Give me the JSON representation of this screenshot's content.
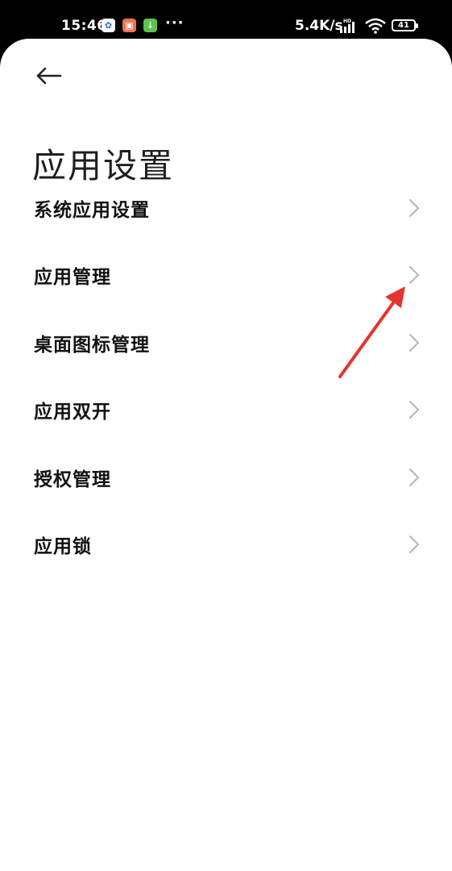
{
  "status_bar": {
    "time": "15:46",
    "app_icons": [
      {
        "name": "baidu-icon",
        "glyph": "✿"
      },
      {
        "name": "shopping-icon",
        "glyph": "▣"
      },
      {
        "name": "download-icon",
        "glyph": "↓"
      }
    ],
    "more": "···",
    "network_speed": "5.4K/s",
    "signal_label": "HD",
    "battery": "41"
  },
  "header": {
    "back_icon": "back-arrow-icon",
    "title": "应用设置"
  },
  "settings": {
    "items": [
      {
        "label": "系统应用设置"
      },
      {
        "label": "应用管理"
      },
      {
        "label": "桌面图标管理"
      },
      {
        "label": "应用双开"
      },
      {
        "label": "授权管理"
      },
      {
        "label": "应用锁"
      }
    ]
  },
  "colors": {
    "background": "#ffffff",
    "status_bar": "#000000",
    "text": "#111111",
    "chevron": "#b5b5b5",
    "annotation": "#e8322c"
  }
}
